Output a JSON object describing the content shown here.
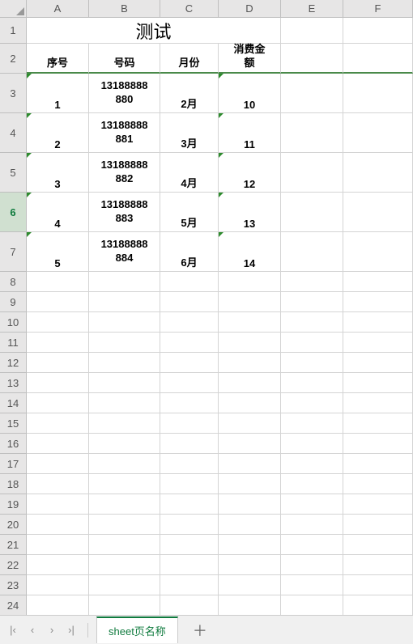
{
  "columns": [
    "A",
    "B",
    "C",
    "D",
    "E",
    "F"
  ],
  "title": "测试",
  "headers": [
    "序号",
    "号码",
    "月份",
    "消费金\n额"
  ],
  "rows": [
    {
      "num": "1",
      "phone": "13188888\n880",
      "month": "2月",
      "amount": "10"
    },
    {
      "num": "2",
      "phone": "13188888\n881",
      "month": "3月",
      "amount": "11"
    },
    {
      "num": "3",
      "phone": "13188888\n882",
      "month": "4月",
      "amount": "12"
    },
    {
      "num": "4",
      "phone": "13188888\n883",
      "month": "5月",
      "amount": "13"
    },
    {
      "num": "5",
      "phone": "13188888\n884",
      "month": "6月",
      "amount": "14"
    }
  ],
  "emptyRows": [
    8,
    9,
    10,
    11,
    12,
    13,
    14,
    15,
    16,
    17,
    18,
    19,
    20,
    21,
    22,
    23,
    24
  ],
  "selectedRow": 6,
  "sheetName": "sheet页名称",
  "chart_data": {
    "type": "table",
    "title": "测试",
    "columns": [
      "序号",
      "号码",
      "月份",
      "消费金额"
    ],
    "data": [
      [
        1,
        "13188888880",
        "2月",
        10
      ],
      [
        2,
        "13188888881",
        "3月",
        11
      ],
      [
        3,
        "13188888882",
        "4月",
        12
      ],
      [
        4,
        "13188888883",
        "5月",
        13
      ],
      [
        5,
        "13188888884",
        "6月",
        14
      ]
    ]
  }
}
